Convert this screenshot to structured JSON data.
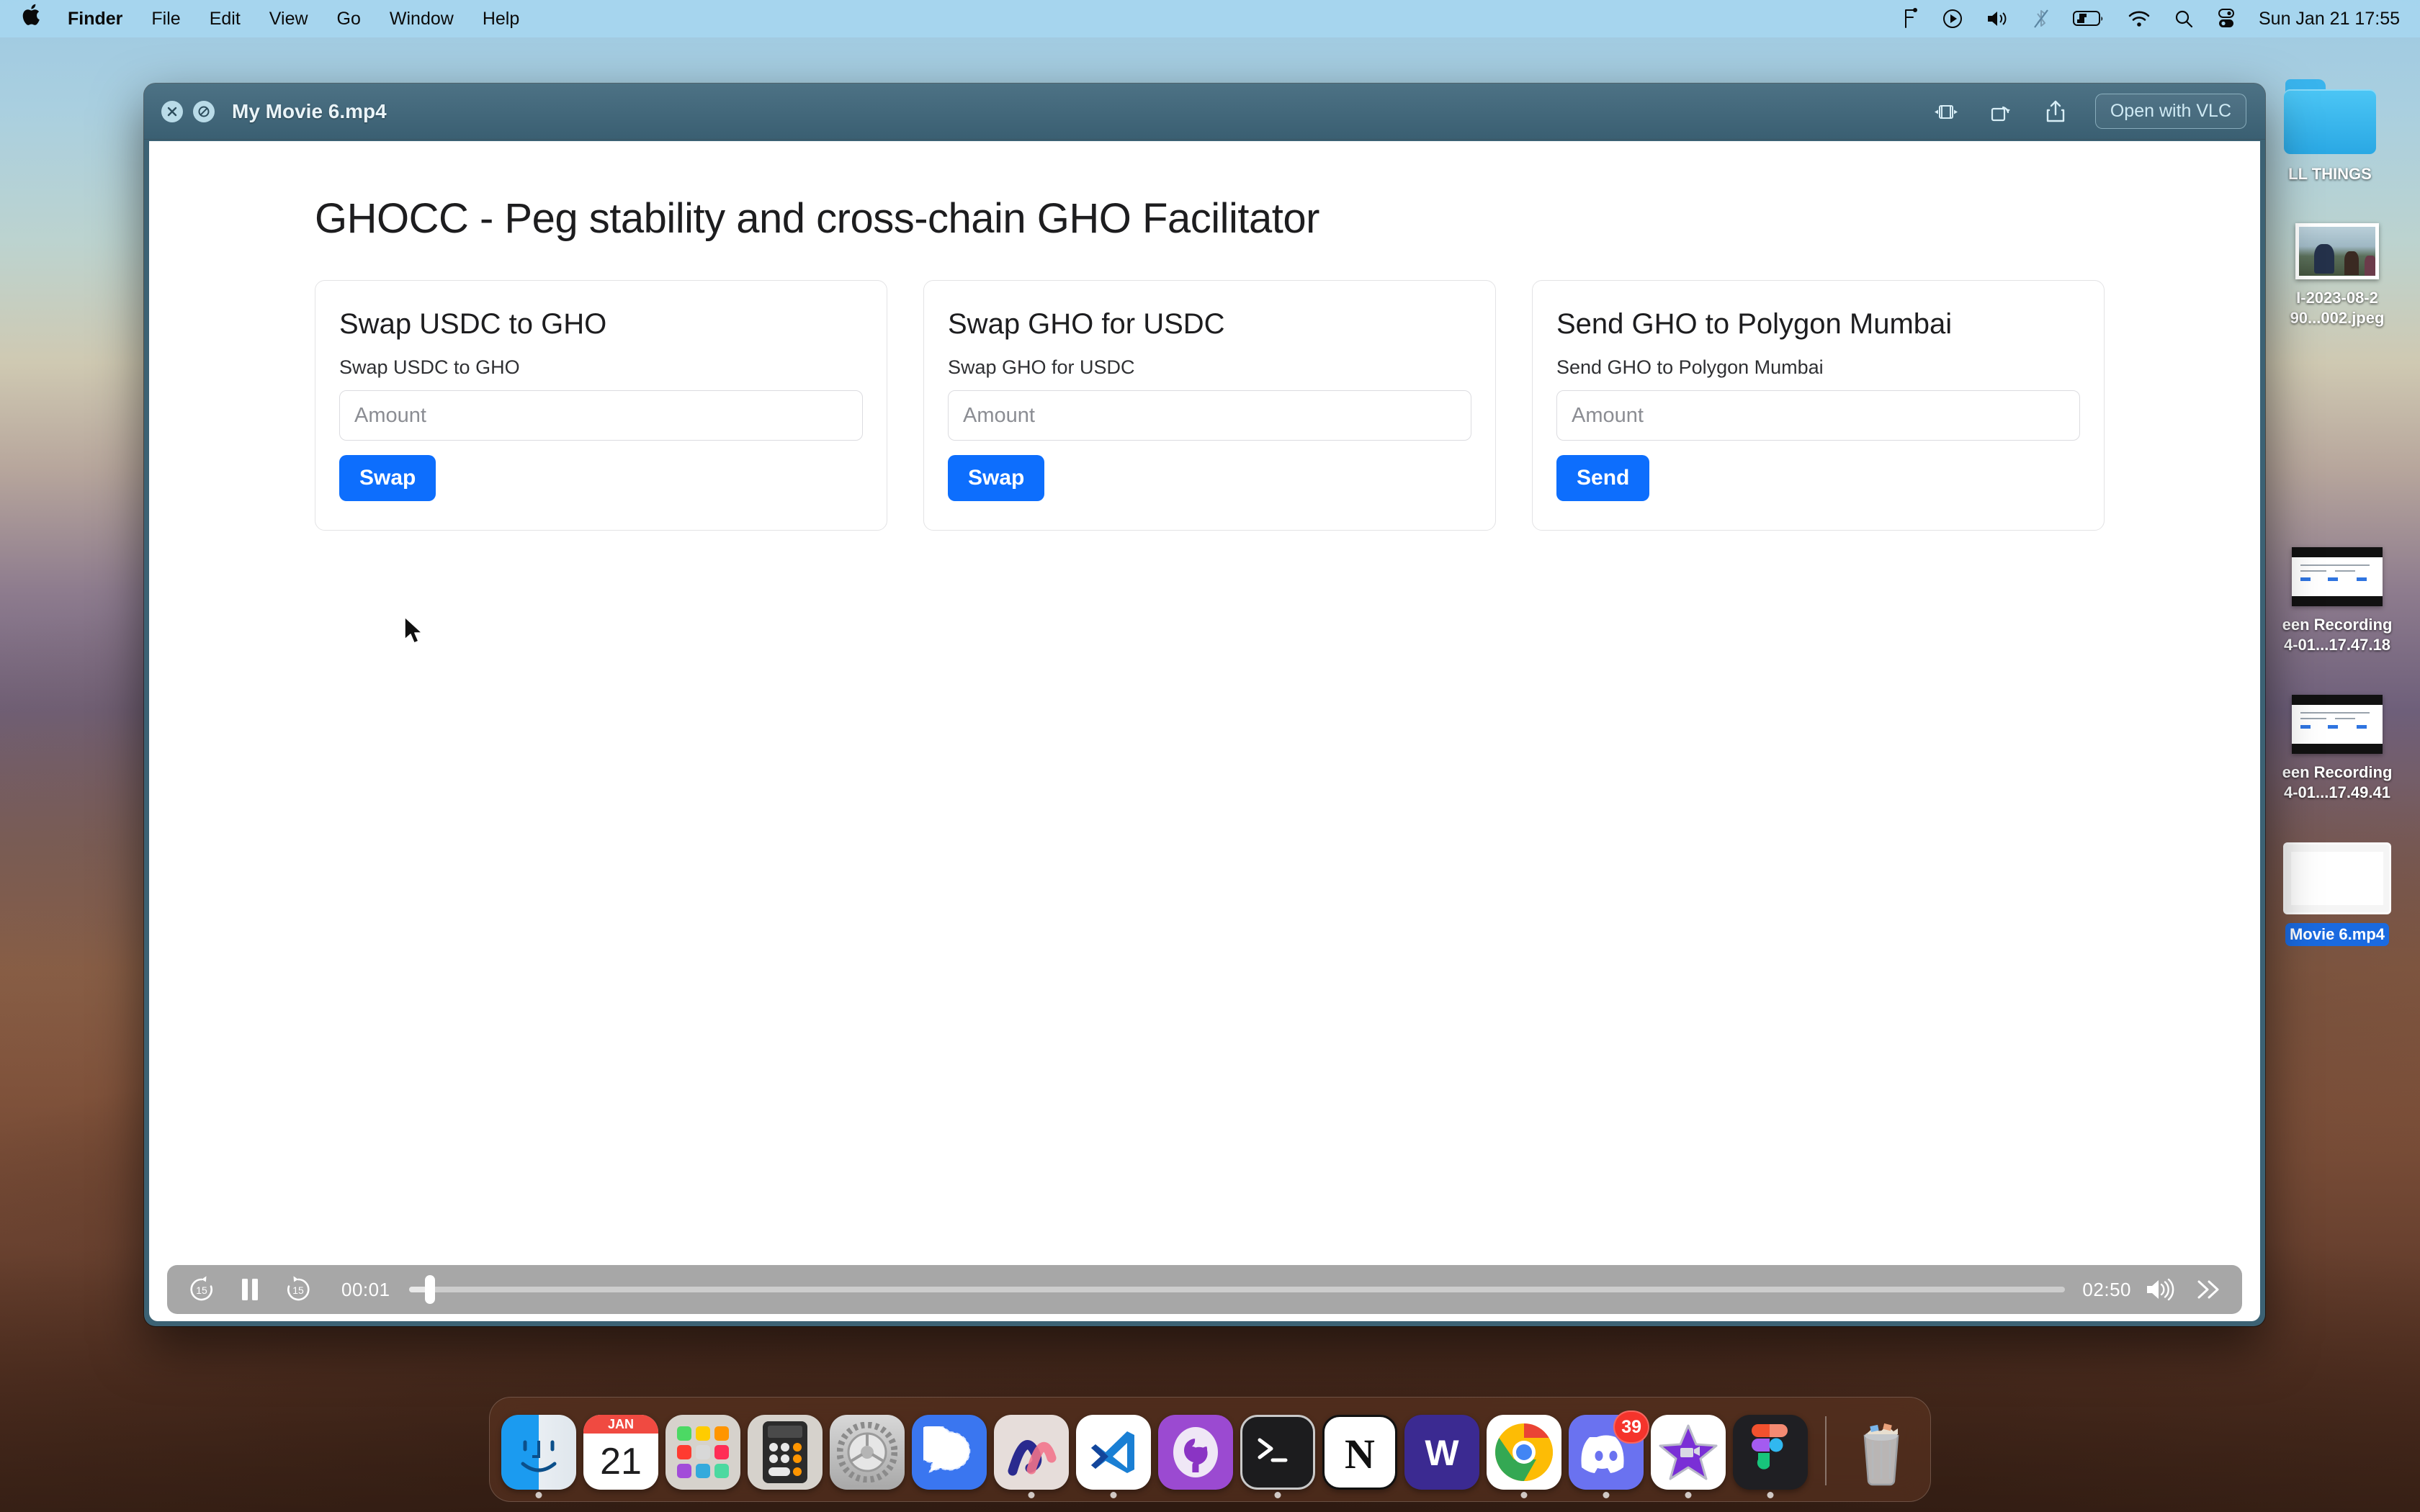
{
  "menubar": {
    "apple_logo": "",
    "items": [
      "Finder",
      "File",
      "Edit",
      "View",
      "Go",
      "Window",
      "Help"
    ],
    "status_icons": [
      "figma-icon",
      "screen-record-icon",
      "volume-icon",
      "bluetooth-off-icon",
      "battery-charging-icon",
      "wifi-icon",
      "search-icon",
      "control-center-icon"
    ],
    "clock": "Sun Jan 21  17:55"
  },
  "desktop_icons": [
    {
      "name": "folder",
      "icon": "folder-icon",
      "label": "LL THINGS"
    },
    {
      "name": "photo",
      "icon": "photo-thumbnail",
      "label_line1": "I-2023-08-2",
      "label_line2": "90...002.jpeg"
    },
    {
      "name": "recording1",
      "icon": "screen-recording-thumbnail",
      "label_line1": "een Recording",
      "label_line2": "4-01...17.47.18"
    },
    {
      "name": "recording2",
      "icon": "screen-recording-thumbnail",
      "label_line1": "een Recording",
      "label_line2": "4-01...17.49.41"
    },
    {
      "name": "movie",
      "icon": "movie-thumbnail",
      "label": "Movie 6.mp4",
      "selected": true
    }
  ],
  "window": {
    "title": "My Movie 6.mp4",
    "close_glyph": "✕",
    "minimize_glyph": "⊘",
    "toolbar": {
      "trim_icon": "trim-icon",
      "rotate_icon": "rotate-icon",
      "share_icon": "share-icon",
      "open_with_label": "Open with VLC"
    }
  },
  "video_page": {
    "heading": "GHOCC - Peg stability and cross-chain GHO Facilitator",
    "cards": [
      {
        "title": "Swap USDC to GHO",
        "subtitle": "Swap USDC to GHO",
        "input_value": "",
        "input_placeholder": "Amount",
        "button_label": "Swap"
      },
      {
        "title": "Swap GHO for USDC",
        "subtitle": "Swap GHO for USDC",
        "input_value": "",
        "input_placeholder": "Amount",
        "button_label": "Swap"
      },
      {
        "title": "Send GHO to Polygon Mumbai",
        "subtitle": "Send GHO to Polygon Mumbai",
        "input_value": "",
        "input_placeholder": "Amount",
        "button_label": "Send"
      }
    ]
  },
  "player": {
    "rewind_label": "15",
    "forward_label": "15",
    "play_state": "paused",
    "current_time": "00:01",
    "duration": "02:50",
    "volume_icon": "volume-high-icon",
    "more_icon": "fast-forward-icon",
    "progress_percent": 0.6
  },
  "dock": {
    "items": [
      {
        "name": "finder",
        "label": "Finder",
        "running": true
      },
      {
        "name": "calendar",
        "label": "Calendar",
        "month": "JAN",
        "day": "21",
        "running": false
      },
      {
        "name": "launchpad",
        "label": "Launchpad",
        "running": false
      },
      {
        "name": "calculator",
        "label": "Calculator",
        "running": false
      },
      {
        "name": "system-settings",
        "label": "System Settings",
        "running": false
      },
      {
        "name": "signal",
        "label": "Signal",
        "running": false
      },
      {
        "name": "arc",
        "label": "Arc",
        "running": true
      },
      {
        "name": "vscode",
        "label": "Visual Studio Code",
        "running": true
      },
      {
        "name": "github-desktop",
        "label": "GitHub Desktop",
        "running": false
      },
      {
        "name": "terminal",
        "label": "Terminal",
        "running": true
      },
      {
        "name": "notion",
        "label": "Notion",
        "running": false
      },
      {
        "name": "word",
        "label": "Microsoft Word",
        "running": false
      },
      {
        "name": "chrome",
        "label": "Google Chrome",
        "running": true
      },
      {
        "name": "discord",
        "label": "Discord",
        "running": true,
        "badge": "39"
      },
      {
        "name": "imovie",
        "label": "iMovie",
        "running": true
      },
      {
        "name": "figma",
        "label": "Figma",
        "running": true
      },
      {
        "name": "trash",
        "label": "Trash",
        "running": false
      }
    ]
  },
  "colors": {
    "accent_blue": "#0d6efd",
    "window_chrome": "#3c6274",
    "menubar": "#a6d6ef",
    "selection": "#1a6ae0"
  }
}
